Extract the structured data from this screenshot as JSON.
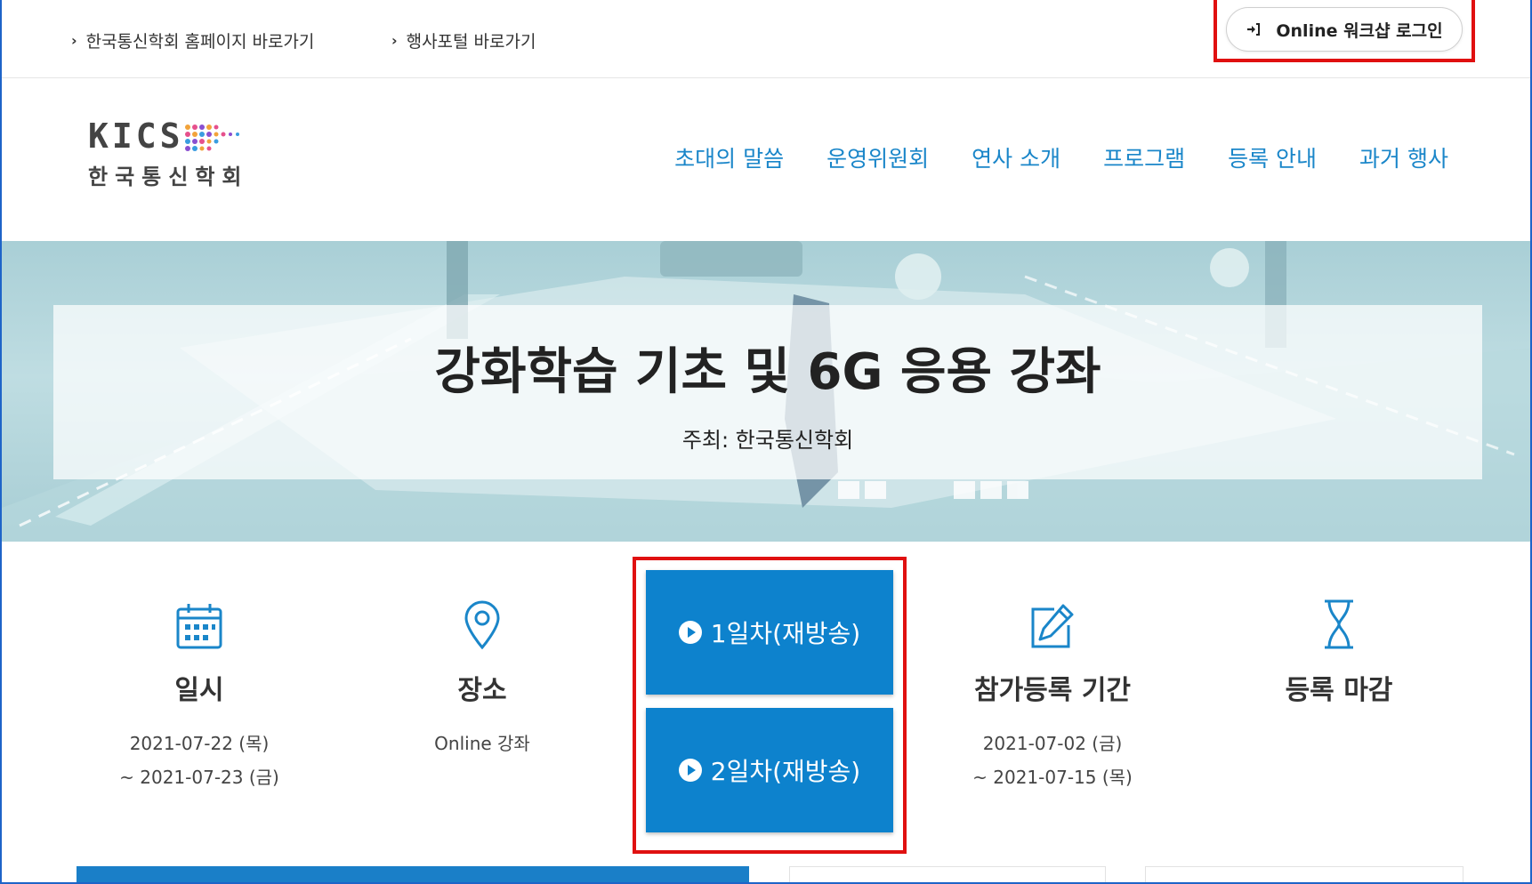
{
  "topbar": {
    "links": [
      {
        "label": "한국통신학회 홈페이지 바로가기"
      },
      {
        "label": "행사포털 바로가기"
      }
    ],
    "login_label": "Online 워크샵 로그인"
  },
  "logo": {
    "wordmark": "KICS",
    "subtitle": "한국통신학회"
  },
  "nav": {
    "items": [
      {
        "label": "초대의 말씀"
      },
      {
        "label": "운영위원회"
      },
      {
        "label": "연사 소개"
      },
      {
        "label": "프로그램"
      },
      {
        "label": "등록 안내"
      },
      {
        "label": "과거 행사"
      }
    ]
  },
  "hero": {
    "title": "강화학습 기초 및 6G 응용 강좌",
    "host": "주최: 한국통신학회"
  },
  "info": {
    "date": {
      "label": "일시",
      "line1": "2021-07-22 (목)",
      "line2": "~ 2021-07-23 (금)"
    },
    "venue": {
      "label": "장소",
      "line1": "Online 강좌"
    },
    "replay": [
      {
        "label": "1일차(재방송)"
      },
      {
        "label": "2일차(재방송)"
      }
    ],
    "registration": {
      "label": "참가등록 기간",
      "line1": "2021-07-02 (금)",
      "line2": "~ 2021-07-15 (목)"
    },
    "deadline": {
      "label": "등록 마감"
    }
  },
  "colors": {
    "accent": "#1a86c9",
    "button": "#0d82cd",
    "highlight": "#e01010"
  }
}
